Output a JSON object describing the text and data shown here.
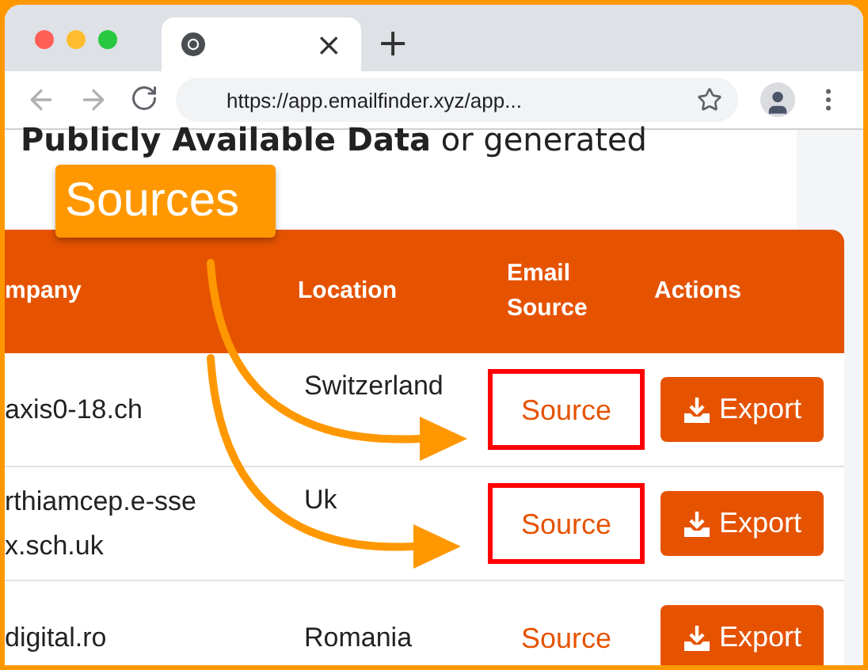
{
  "browser": {
    "tab_close": "×",
    "new_tab": "+",
    "url": "https://app.emailfinder.xyz/app..."
  },
  "heading": "**Publicly Available Data** or generated",
  "callout": {
    "label": "Sources"
  },
  "table": {
    "columns": [
      "mpany",
      "Location",
      "Email Source",
      "Actions"
    ],
    "rows": [
      {
        "company": "axis0-18.ch",
        "location": "Switzerland",
        "source": "Source",
        "action": "Export",
        "highlighted": true
      },
      {
        "company": "rthiamcep.e-ssex.sch.uk",
        "location": "Uk",
        "source": "Source",
        "action": "Export",
        "highlighted": true
      },
      {
        "company": "digital.ro",
        "location": "Romania",
        "source": "Source",
        "action": "Export",
        "highlighted": false
      }
    ]
  }
}
